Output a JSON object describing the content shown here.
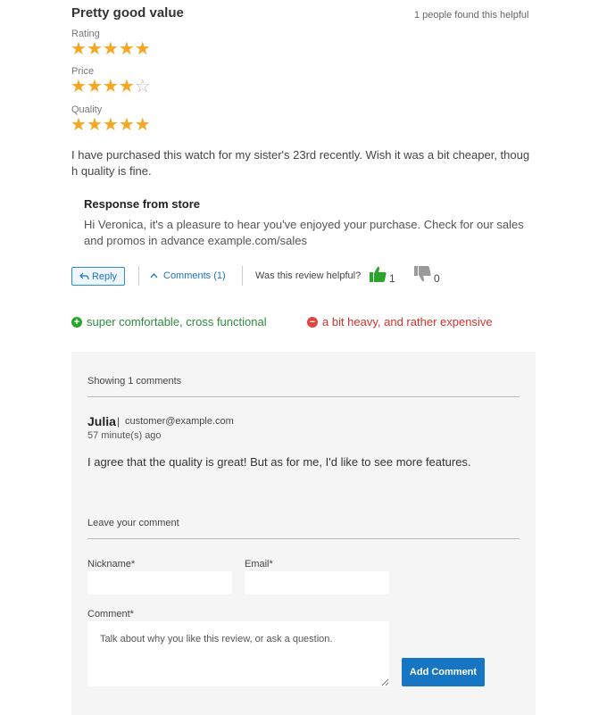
{
  "review": {
    "title": "Pretty good value",
    "helpful_count_text": "1 people found this helpful",
    "ratings": [
      {
        "label": "Rating",
        "stars": 5,
        "max": 5
      },
      {
        "label": "Price",
        "stars": 4,
        "max": 5
      },
      {
        "label": "Quality",
        "stars": 5,
        "max": 5
      }
    ],
    "body": "I have purchased this watch for my sister's 23rd recently. Wish it was a bit cheaper, though quality is fine.",
    "response": {
      "title": "Response from store",
      "text": "Hi Veronica, it's a pleasure to hear you've enjoyed your purchase. Check for our sales and promos in advance example.com/sales"
    },
    "actions": {
      "reply_label": "Reply",
      "comments_label": "Comments (1)",
      "was_helpful_label": "Was this review helpful?",
      "helpful_yes_count": "1",
      "helpful_no_count": "0"
    },
    "pros": "super comfortable, cross functional",
    "cons": "a bit heavy, and rather expensive"
  },
  "comments": {
    "showing_text": "Showing 1 comments",
    "items": [
      {
        "author": "Julia",
        "separator": "|",
        "email": "customer@example.com",
        "time": "57 minute(s) ago",
        "text": "I agree that the quality is great! But as for me, I'd like to see more features."
      }
    ]
  },
  "comment_form": {
    "heading": "Leave your comment",
    "nickname_label": "Nickname*",
    "nickname_value": "",
    "email_label": "Email*",
    "email_value": "",
    "comment_label": "Comment*",
    "comment_placeholder": "Talk about why you like this review, or ask a question.",
    "submit_label": "Add Comment"
  },
  "colors": {
    "star": "#f5a623",
    "star_empty": "#b8b8b8",
    "link": "#1e73be",
    "pro": "#2e8b3d",
    "con": "#d0322d",
    "thumb_up": "#2aa52a",
    "thumb_down": "#9a9a9a",
    "button": "#1676c4"
  },
  "icons": {
    "reply": "reply-arrow-icon",
    "comments": "chevron-up-icon",
    "helpful_yes": "thumbs-up-icon",
    "helpful_no": "thumbs-down-icon",
    "pro": "plus-circle-icon",
    "con": "minus-circle-icon"
  }
}
